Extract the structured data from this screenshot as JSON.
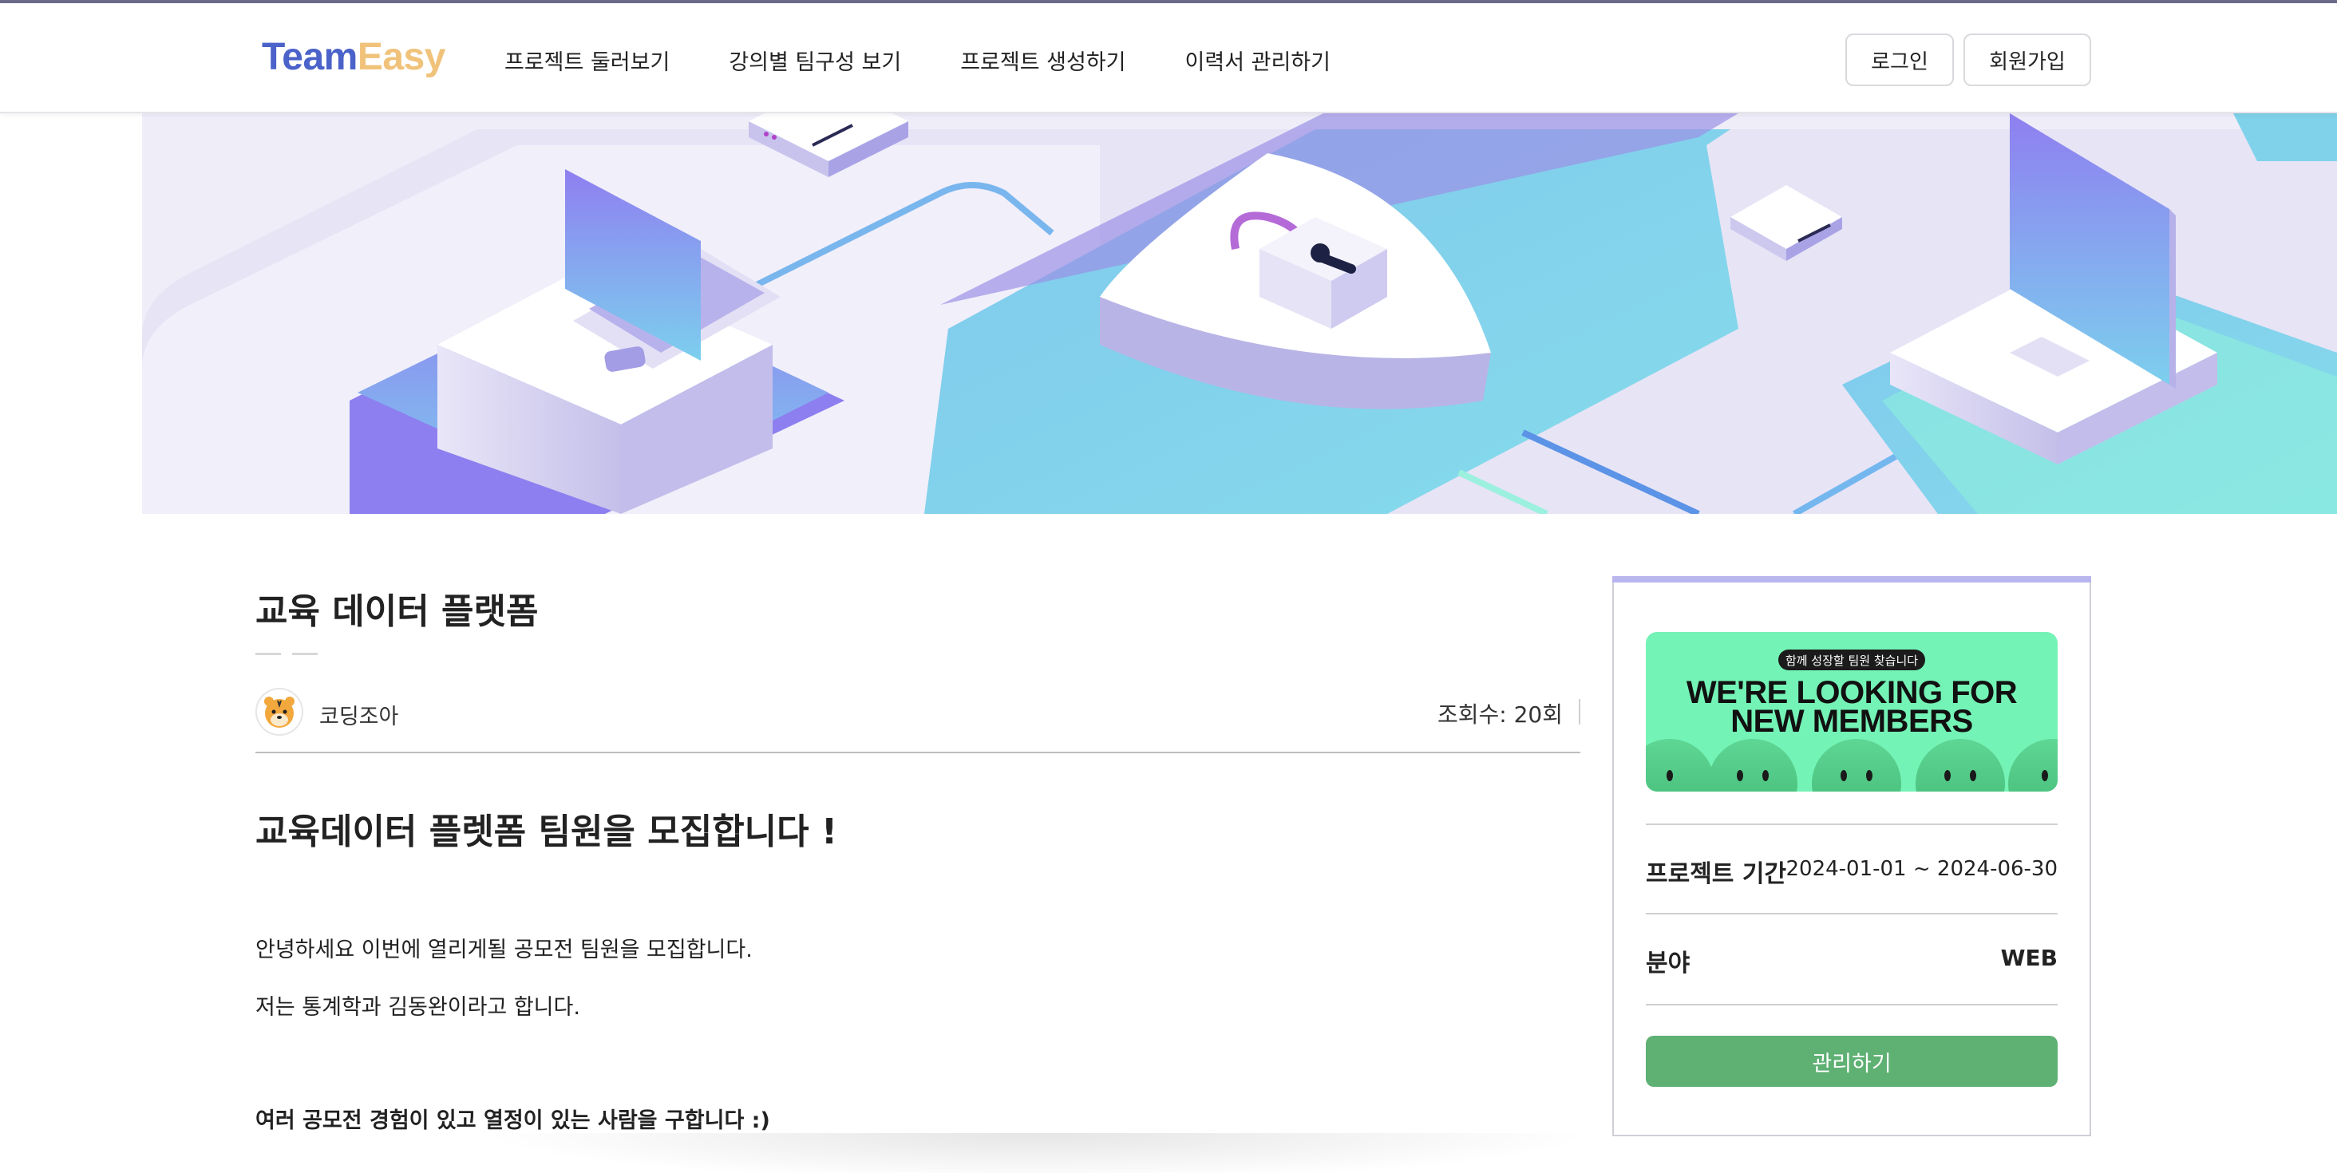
{
  "header": {
    "logo_part1": "Team",
    "logo_part2": "Easy",
    "nav": [
      {
        "label": "프로젝트 둘러보기"
      },
      {
        "label": "강의별 팀구성 보기"
      },
      {
        "label": "프로젝트 생성하기"
      },
      {
        "label": "이력서 관리하기"
      }
    ],
    "login_label": "로그인",
    "signup_label": "회원가입"
  },
  "post": {
    "title": "교육 데이터 플랫폼",
    "author": "코딩조아",
    "views": "조회수: 20회",
    "headline": "교육데이터 플렛폼 팀원을 모집합니다 !",
    "paragraphs": [
      "안녕하세요 이번에 열리게될 공모전 팀원을 모집합니다.",
      "저는 통계학과 김동완이라고 합니다.",
      "여러 공모전 경험이 있고 열정이 있는 사람을 구합니다 :)"
    ]
  },
  "sidebar": {
    "promo_pill": "함께 성장할 팀원 찾습니다",
    "promo_line1": "WE'RE LOOKING FOR",
    "promo_line2": "NEW MEMBERS",
    "period_label": "프로젝트 기간",
    "period_value": "2024-01-01 ~ 2024-06-30",
    "field_label": "분야",
    "field_value": "WEB",
    "manage_label": "관리하기"
  },
  "colors": {
    "logo_blue": "#4a62c9",
    "logo_yellow": "#f0c27a",
    "manage_green": "#5eb073",
    "promo_green": "#74f3b6",
    "card_accent": "#b9b6ef"
  },
  "icons": [
    "tiger-avatar-icon",
    "lock-icon",
    "laptop-icon",
    "monitor-icon",
    "server-icon",
    "shield-icon"
  ]
}
